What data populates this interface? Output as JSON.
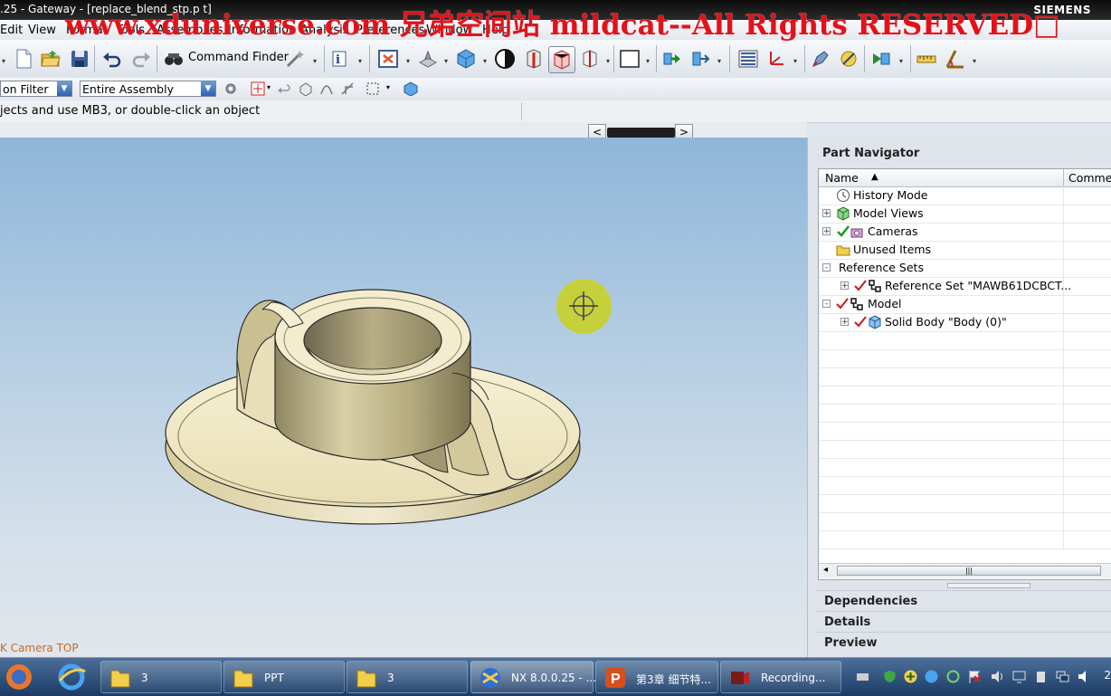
{
  "window": {
    "title": ".25 - Gateway - [replace_blend_stp.p  t]",
    "brand": "SIEMENS"
  },
  "watermark": "www.xduniverse.com 兄弟空间站 mildcat--All Rights RESERVED□",
  "menu": [
    "Edit",
    "View",
    "Format",
    "Tools",
    "Assemblies",
    "Information",
    "Analysis",
    "Preferences",
    "Window",
    "Help"
  ],
  "toolbar": {
    "command_finder": "Command Finder"
  },
  "selection_bar": {
    "type_filter": "on Filter",
    "scope": "Entire Assembly"
  },
  "status": {
    "prompt": "jects and use MB3, or double-click an object"
  },
  "viewport": {
    "orientation": "K Camera TOP",
    "model_color": "#efe7c2"
  },
  "part_navigator": {
    "title": "Part Navigator",
    "columns": [
      "Name",
      "Commen"
    ],
    "rows": [
      {
        "label": "History Mode",
        "icon": "clock-icon",
        "level": 0,
        "expander": ""
      },
      {
        "label": "Model Views",
        "icon": "model-views-icon",
        "level": 0,
        "expander": "+"
      },
      {
        "label": "Cameras",
        "icon": "camera-icon",
        "level": 0,
        "expander": "+"
      },
      {
        "label": "Unused Items",
        "icon": "folder-icon",
        "level": 0,
        "expander": ""
      },
      {
        "label": "Reference Sets",
        "icon": "",
        "level": 0,
        "expander": "-"
      },
      {
        "label": "Reference Set \"MAWB61DCBCT...",
        "icon": "reference-set-icon",
        "level": 1,
        "expander": "+"
      },
      {
        "label": "Model",
        "icon": "model-icon",
        "level": 0,
        "expander": "-"
      },
      {
        "label": "Solid Body \"Body (0)\"",
        "icon": "solid-body-icon",
        "level": 1,
        "expander": "+"
      }
    ],
    "sections": [
      "Dependencies",
      "Details",
      "Preview"
    ]
  },
  "taskbar": {
    "tasks": [
      "3",
      "PPT",
      "3",
      "NX 8.0.0.25 - ...",
      "第3章 细节特...",
      "Recording..."
    ],
    "clock": "2"
  }
}
